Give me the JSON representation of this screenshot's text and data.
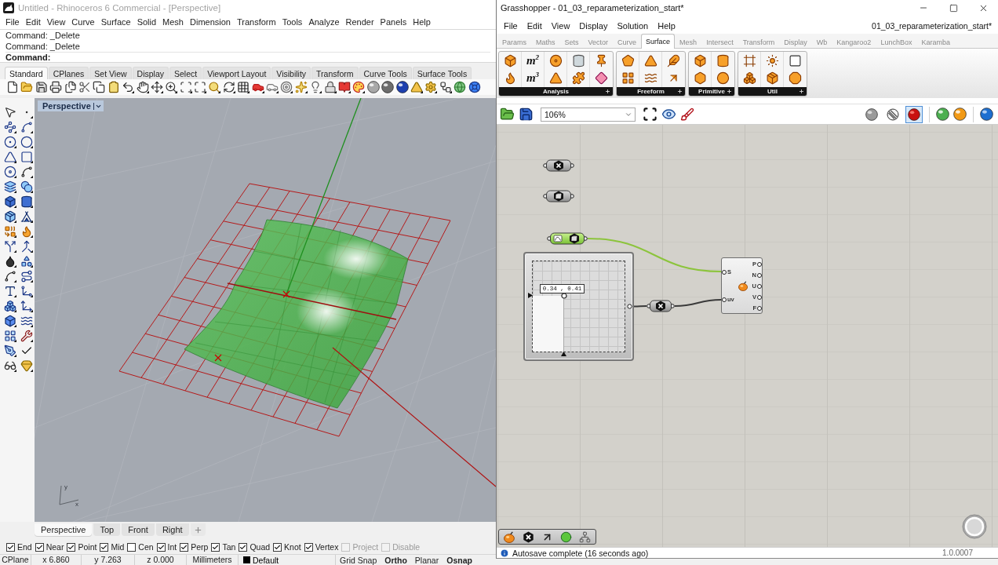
{
  "rhino": {
    "window": {
      "title": "Untitled - Rhinoceros 6 Commercial - [Perspective]"
    },
    "menu": [
      "File",
      "Edit",
      "View",
      "Curve",
      "Surface",
      "Solid",
      "Mesh",
      "Dimension",
      "Transform",
      "Tools",
      "Analyze",
      "Render",
      "Panels",
      "Help"
    ],
    "command_history": [
      "Command: _Delete",
      "Command: _Delete"
    ],
    "command_prompt": "Command:",
    "toolbar_tabs": [
      {
        "label": "Standard",
        "selected": true
      },
      {
        "label": "CPlanes",
        "selected": false
      },
      {
        "label": "Set View",
        "selected": false
      },
      {
        "label": "Display",
        "selected": false
      },
      {
        "label": "Select",
        "selected": false
      },
      {
        "label": "Viewport Layout",
        "selected": false
      },
      {
        "label": "Visibility",
        "selected": false
      },
      {
        "label": "Transform",
        "selected": false
      },
      {
        "label": "Curve Tools",
        "selected": false
      },
      {
        "label": "Surface Tools",
        "selected": false
      }
    ],
    "viewport": {
      "title": "Perspective",
      "axis_labels": [
        "y",
        "x"
      ]
    },
    "viewport_tabs": [
      {
        "label": "Perspective",
        "selected": true
      },
      {
        "label": "Top",
        "selected": false
      },
      {
        "label": "Front",
        "selected": false
      },
      {
        "label": "Right",
        "selected": false
      }
    ],
    "osnaps": [
      {
        "label": "End",
        "checked": true,
        "disabled": false
      },
      {
        "label": "Near",
        "checked": true,
        "disabled": false
      },
      {
        "label": "Point",
        "checked": true,
        "disabled": false
      },
      {
        "label": "Mid",
        "checked": true,
        "disabled": false
      },
      {
        "label": "Cen",
        "checked": false,
        "disabled": false
      },
      {
        "label": "Int",
        "checked": true,
        "disabled": false
      },
      {
        "label": "Perp",
        "checked": true,
        "disabled": false
      },
      {
        "label": "Tan",
        "checked": true,
        "disabled": false
      },
      {
        "label": "Quad",
        "checked": true,
        "disabled": false
      },
      {
        "label": "Knot",
        "checked": true,
        "disabled": false
      },
      {
        "label": "Vertex",
        "checked": true,
        "disabled": false
      },
      {
        "label": "Project",
        "checked": false,
        "disabled": true
      },
      {
        "label": "Disable",
        "checked": false,
        "disabled": true
      }
    ],
    "status_bar": {
      "cplane": "CPlane",
      "coordinates": [
        "x 6.860",
        "y 7.263",
        "z 0.000"
      ],
      "units": "Millimeters",
      "layer": "Default",
      "toggles": [
        {
          "label": "Grid Snap",
          "on": false
        },
        {
          "label": "Ortho",
          "on": true
        },
        {
          "label": "Planar",
          "on": false
        },
        {
          "label": "Osnap",
          "on": true
        }
      ]
    }
  },
  "grasshopper": {
    "window": {
      "title": "Grasshopper - 01_03_reparameterization_start*"
    },
    "menu": [
      "File",
      "Edit",
      "View",
      "Display",
      "Solution",
      "Help"
    ],
    "document_tab": "01_03_reparameterization_start*",
    "tabs": [
      {
        "label": "Params",
        "selected": false
      },
      {
        "label": "Maths",
        "selected": false
      },
      {
        "label": "Sets",
        "selected": false
      },
      {
        "label": "Vector",
        "selected": false
      },
      {
        "label": "Curve",
        "selected": false
      },
      {
        "label": "Surface",
        "selected": true
      },
      {
        "label": "Mesh",
        "selected": false
      },
      {
        "label": "Intersect",
        "selected": false
      },
      {
        "label": "Transform",
        "selected": false
      },
      {
        "label": "Display",
        "selected": false
      },
      {
        "label": "Wb",
        "selected": false
      },
      {
        "label": "Kangaroo2",
        "selected": false
      },
      {
        "label": "LunchBox",
        "selected": false
      },
      {
        "label": "Karamba",
        "selected": false
      }
    ],
    "panels": [
      {
        "label": "Analysis",
        "glyphs": [
          "m$^{2}$",
          "m$^{3}$"
        ]
      },
      {
        "label": "Freeform"
      },
      {
        "label": "Primitive"
      },
      {
        "label": "Util"
      }
    ],
    "zoom": "106%",
    "preview_modes": [
      {
        "selected": false
      },
      {
        "selected": false
      },
      {
        "selected": true
      }
    ],
    "components": [
      {
        "kind": "point_param",
        "selected": false,
        "reparameterized": false
      },
      {
        "kind": "surface_param",
        "selected": false,
        "reparameterized": false
      },
      {
        "kind": "surface_param",
        "selected": true,
        "reparameterized": true
      },
      {
        "kind": "md_slider",
        "selected": false,
        "value": "0.34 , 0.41",
        "level": 0.34
      },
      {
        "kind": "point_param",
        "selected": false,
        "reparameterized": false
      },
      {
        "kind": "evaluate_surface",
        "selected": false,
        "inputs": [
          "S",
          "uv"
        ],
        "outputs": [
          "P",
          "N",
          "U",
          "V",
          "F"
        ]
      }
    ],
    "status_bar": {
      "message": "Autosave complete (16 seconds ago)",
      "version": "1.0.0007"
    }
  }
}
